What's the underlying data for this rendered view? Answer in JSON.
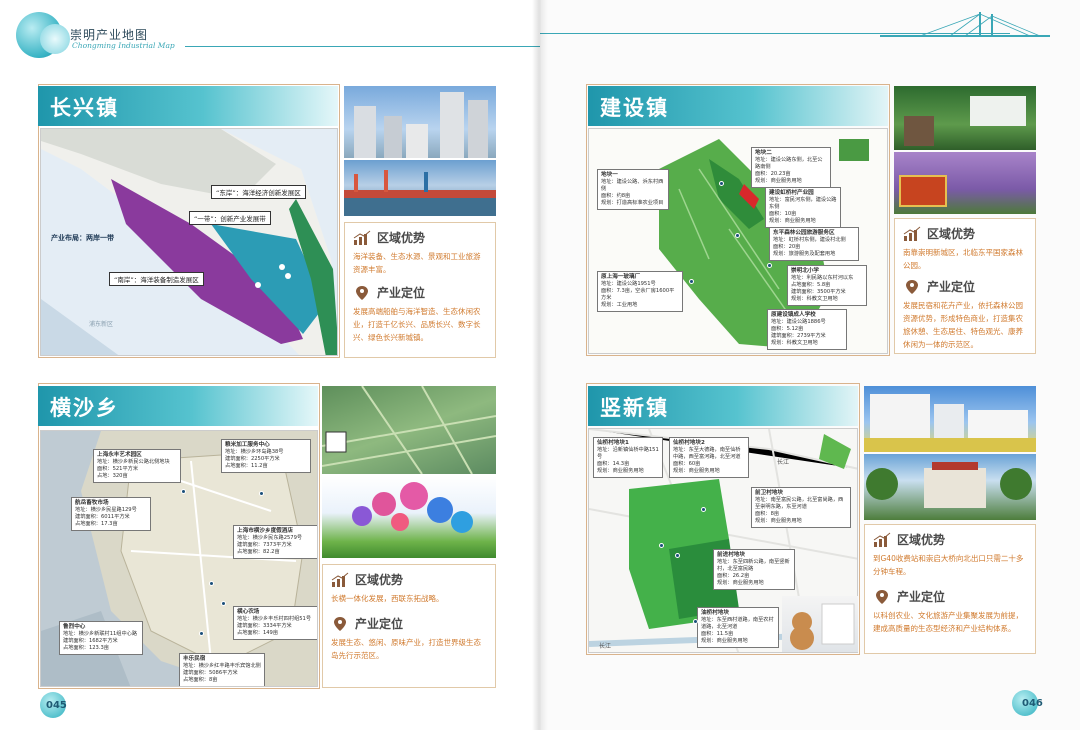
{
  "header": {
    "title": "崇明产业地图",
    "subtitle": "Chongming Industrial Map"
  },
  "page_left": "045",
  "page_right": "046",
  "sections": {
    "changxing": {
      "name": "长兴镇",
      "layout_label": "产业布局：两岸一带",
      "zones": [
        "“东岸”：海洋经济创新发展区",
        "“一带”：创新产业发展带",
        "“南岸”：海洋装备制造发展区"
      ],
      "advantage_title": "区域优势",
      "advantage_text": "海洋装备、生态水源、景观和工业旅游资源丰富。",
      "positioning_title": "产业定位",
      "positioning_text": "发展高端船舶与海洋智造、生态休闲农业，打造千亿长兴、品质长兴、数字长兴、绿色长兴新城镇。"
    },
    "jianshe": {
      "name": "建设镇",
      "sites": [
        {
          "name": "地块一",
          "text": "地址：建设公路、浜东村西侧\n面积：约8亩\n规划：打造高标准农业项目"
        },
        {
          "name": "地块二",
          "text": "地址：建设公路东侧，北至公路南侧\n面积：20.23亩\n规划：商业服务用地"
        },
        {
          "name": "建设虹桥村产业园",
          "text": "地址：富民河东侧，建设公路东侧\n面积：10亩\n规划：商业服务用地"
        },
        {
          "name": "东平森林公园旅游服务区",
          "text": "地址：虹桥村东侧，建设村北侧\n面积：20亩\n规划：旅游服务及配套用地"
        },
        {
          "name": "崇明北小学",
          "text": "地址：利民路以东村河以东\n占地面积：5.8亩\n建筑面积：3500平方米\n规划：科教文卫用地"
        },
        {
          "name": "原上海一玻璃厂",
          "text": "地址：建设公路1951号\n面积：7.3亩，空余厂房1600平方米\n规划：工业用地"
        },
        {
          "name": "原建设镇成人学校",
          "text": "地址：建设公路1886号\n面积：5.12亩\n建筑面积：2739平方米\n规划：科教文卫用地"
        }
      ],
      "advantage_title": "区域优势",
      "advantage_text": "南靠崇明新城区，北临东平国家森林公园。",
      "positioning_title": "产业定位",
      "positioning_text": "发展民宿和花卉产业，依托森林公园资源优势，形成特色商业，打造集农旅休憩、生态居住、特色观光、康养休闲为一体的示范区。"
    },
    "hengsha": {
      "name": "横沙乡",
      "sites": [
        {
          "name": "上海永丰艺术园区",
          "text": "地址：横沙乡新民公路北侧地块\n面积：521平方米\n占地：320亩"
        },
        {
          "name": "粮米加工服务中心",
          "text": "地址：横沙乡环岛路38号\n建筑面积：2250平方米\n占地面积：11.2亩"
        },
        {
          "name": "航岳畜牧市场",
          "text": "地址：横沙乡民星路129号\n建筑面积：6011平方米\n占地面积：17.3亩"
        },
        {
          "name": "上海市横沙乡度假酒店",
          "text": "地址：横沙乡民东路2579号\n建筑面积：7373平方米\n占地面积：82.2亩"
        },
        {
          "name": "横心农场",
          "text": "地址：横沙乡丰乐村四村组51号\n建筑面积：3334平方米\n占地面积：149亩"
        },
        {
          "name": "鲁烈中心",
          "text": "地址：横沙乡新联村11组中心路\n建筑面积：1682平方米\n占地面积：123.3亩"
        },
        {
          "name": "丰乐民宿",
          "text": "地址：横沙乡红丰路丰乐宾馆北侧\n建筑面积：5086平方米\n占地面积：8亩"
        }
      ],
      "advantage_title": "区域优势",
      "advantage_text": "长横一体化发展，西联东拓战略。",
      "positioning_title": "产业定位",
      "positioning_text": "发展生态、悠闲、原味产业，打造世界级生态岛先行示范区。"
    },
    "shuxin": {
      "name": "竖新镇",
      "sites": [
        {
          "name": "仙桥村地块1",
          "text": "地址：沿新镇仙桥中路151号\n面积：14.3亩\n规划：商业服务用地"
        },
        {
          "name": "仙桥村地块2",
          "text": "地址：东至大德路，南至仙桥中路，西至富河路，北至河道\n面积：60亩\n规划：商业服务用地"
        },
        {
          "name": "前卫村地块",
          "text": "地址：南至富民公路，北至富尚路，西至崇明东路，东至河道\n面积：8亩\n规划：商业服务用地"
        },
        {
          "name": "前进村地块",
          "text": "地址：东至四新公路，南至竖新村，北至富民路\n面积：26.2亩\n规划：商业服务用地"
        },
        {
          "name": "油桥村地块",
          "text": "地址：东至西村道路，南至农村道路，北至河道\n面积：11.5亩\n规划：商业服务用地"
        }
      ],
      "river_labels": [
        "长江",
        "长江"
      ],
      "advantage_title": "区域优势",
      "advantage_text": "到G40收费站和崇启大桥向北出口只需二十多分钟车程。",
      "positioning_title": "产业定位",
      "positioning_text": "以科创农业、文化旅游产业集聚发展为前提，建成高质量的生态型经济和产业结构体系。"
    }
  },
  "map_watermark": "浦东新区"
}
